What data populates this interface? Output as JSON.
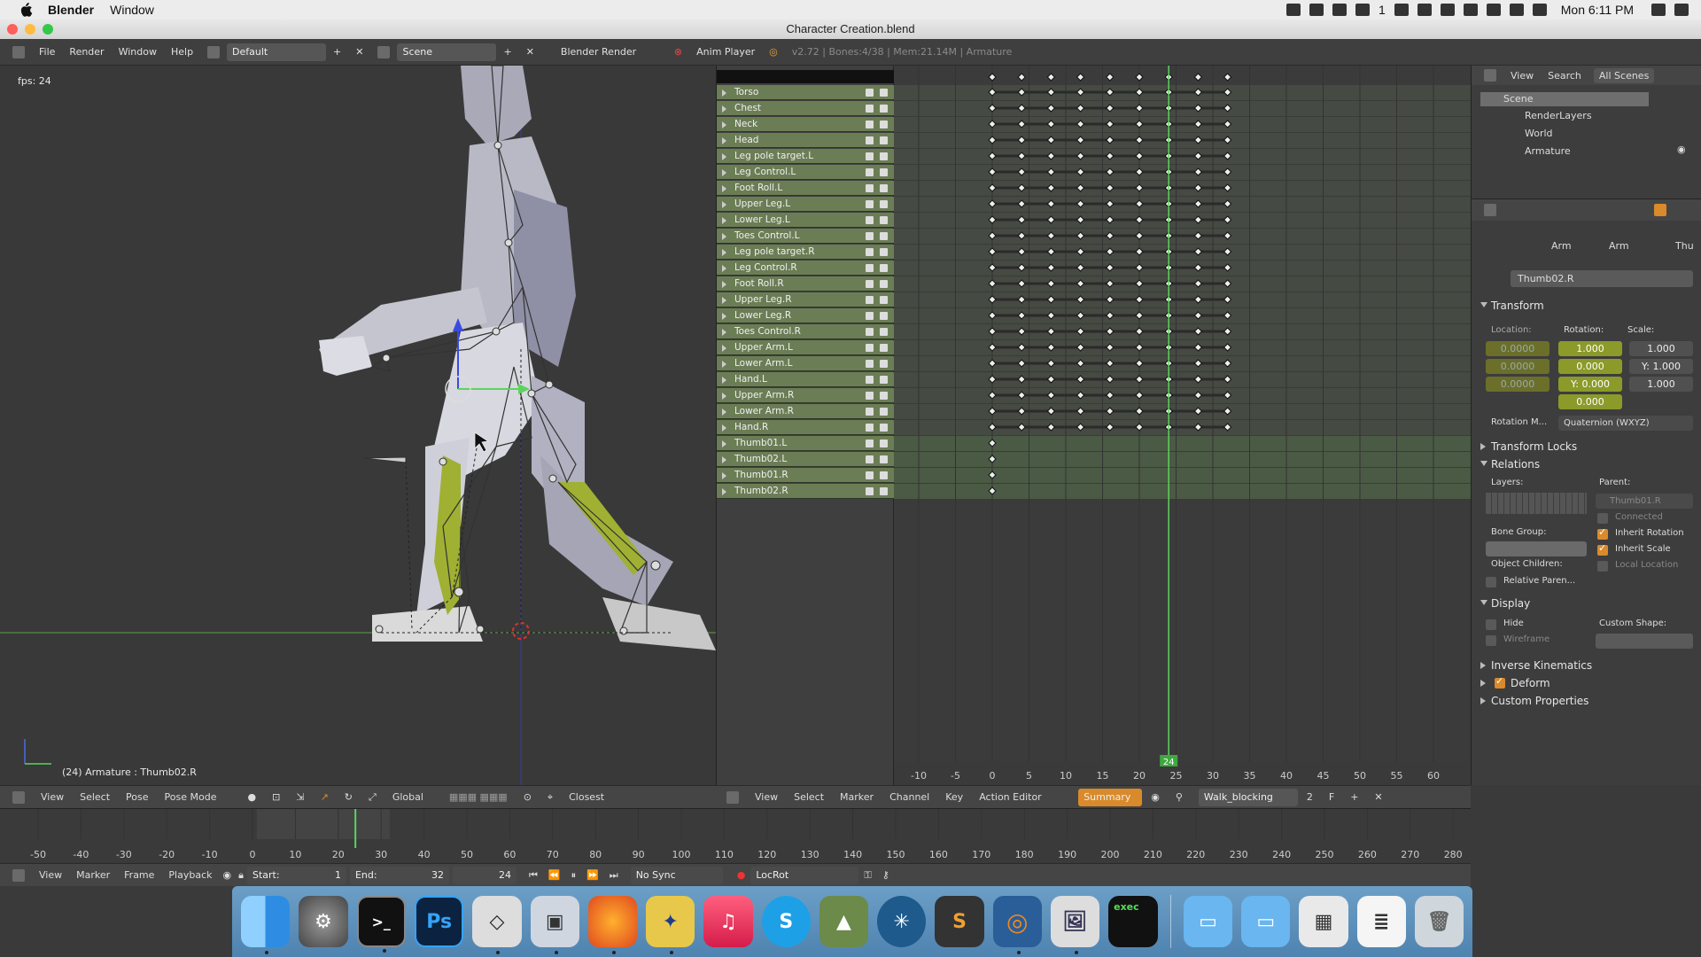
{
  "menubar": {
    "app_name": "Blender",
    "items": [
      "Window"
    ],
    "battery_label": "1",
    "clock": "Mon 6:11 PM"
  },
  "window": {
    "title": "Character Creation.blend"
  },
  "info_header": {
    "menus": [
      "File",
      "Render",
      "Window",
      "Help"
    ],
    "screen_layout": "Default",
    "scene": "Scene",
    "render_engine": "Blender Render",
    "anim_player": "Anim Player",
    "stats": "v2.72 | Bones:4/38 | Mem:21.14M | Armature"
  },
  "viewport": {
    "fps": "fps: 24",
    "object_info": "(24) Armature : Thumb02.R",
    "header": {
      "menus": [
        "View",
        "Select",
        "Pose"
      ],
      "mode": "Pose Mode",
      "orientation": "Global",
      "snap": "Closest"
    }
  },
  "dopesheet": {
    "channels": [
      {
        "name": "Torso",
        "keys": "full"
      },
      {
        "name": "Chest",
        "keys": "full"
      },
      {
        "name": "Neck",
        "keys": "full"
      },
      {
        "name": "Head",
        "keys": "full"
      },
      {
        "name": "Leg pole target.L",
        "keys": "full"
      },
      {
        "name": "Leg Control.L",
        "keys": "full"
      },
      {
        "name": "Foot Roll.L",
        "keys": "full"
      },
      {
        "name": "Upper Leg.L",
        "keys": "full"
      },
      {
        "name": "Lower Leg.L",
        "keys": "full"
      },
      {
        "name": "Toes Control.L",
        "keys": "full"
      },
      {
        "name": "Leg pole target.R",
        "keys": "full"
      },
      {
        "name": "Leg Control.R",
        "keys": "full"
      },
      {
        "name": "Foot Roll.R",
        "keys": "full"
      },
      {
        "name": "Upper Leg.R",
        "keys": "full"
      },
      {
        "name": "Lower Leg.R",
        "keys": "full"
      },
      {
        "name": "Toes Control.R",
        "keys": "full"
      },
      {
        "name": "Upper Arm.L",
        "keys": "full"
      },
      {
        "name": "Lower Arm.L",
        "keys": "full"
      },
      {
        "name": "Hand.L",
        "keys": "full"
      },
      {
        "name": "Upper Arm.R",
        "keys": "full"
      },
      {
        "name": "Lower Arm.R",
        "keys": "full"
      },
      {
        "name": "Hand.R",
        "keys": "full"
      },
      {
        "name": "Thumb01.L",
        "keys": "single"
      },
      {
        "name": "Thumb02.L",
        "keys": "single"
      },
      {
        "name": "Thumb01.R",
        "keys": "single"
      },
      {
        "name": "Thumb02.R",
        "keys": "single"
      }
    ],
    "key_frames": [
      0,
      4,
      8,
      12,
      16,
      20,
      24,
      28,
      32
    ],
    "current_frame": "24",
    "ruler": [
      "-10",
      "-5",
      "0",
      "5",
      "10",
      "15",
      "20",
      "25",
      "30",
      "35",
      "40",
      "45",
      "50",
      "55",
      "60"
    ],
    "header": {
      "menus": [
        "View",
        "Select",
        "Marker",
        "Channel",
        "Key"
      ],
      "editor": "Action Editor",
      "summary": "Summary",
      "action": "Walk_blocking",
      "users": "2",
      "fake_user": "F"
    }
  },
  "outliner": {
    "header": {
      "view": "View",
      "search": "Search",
      "filter": "All Scenes"
    },
    "items": [
      "Scene",
      "RenderLayers",
      "World",
      "Armature"
    ]
  },
  "properties": {
    "tabs": [
      "Arm",
      "Arm",
      "Thu"
    ],
    "bone_name": "Thumb02.R",
    "transform": {
      "label": "Transform",
      "location_label": "Location:",
      "rotation_label": "Rotation:",
      "scale_label": "Scale:",
      "location": [
        "0.0000",
        "0.0000",
        "0.0000"
      ],
      "rotation": [
        "1.000",
        "0.000",
        "Y: 0.000",
        "0.000"
      ],
      "scale": [
        "1.000",
        "Y: 1.000",
        "1.000"
      ],
      "rotation_mode_label": "Rotation M...",
      "rotation_mode": "Quaternion (WXYZ)"
    },
    "panels": {
      "transform_locks": "Transform Locks",
      "relations": "Relations",
      "display": "Display",
      "inverse_kinematics": "Inverse Kinematics",
      "deform": "Deform",
      "custom_properties": "Custom Properties"
    },
    "relations": {
      "layers_label": "Layers:",
      "parent_label": "Parent:",
      "parent_value": "Thumb01.R",
      "connected": "Connected",
      "inherit_rotation": "Inherit Rotation",
      "inherit_scale": "Inherit Scale",
      "bone_group_label": "Bone Group:",
      "object_children_label": "Object Children:",
      "local_location": "Local Location",
      "relative_parent": "Relative Paren..."
    },
    "display": {
      "hide": "Hide",
      "custom_shape_label": "Custom Shape:",
      "wireframe": "Wireframe"
    }
  },
  "timeline": {
    "ruler": [
      "-50",
      "-40",
      "-30",
      "-20",
      "-10",
      "0",
      "10",
      "20",
      "30",
      "40",
      "50",
      "60",
      "70",
      "80",
      "90",
      "100",
      "110",
      "120",
      "130",
      "140",
      "150",
      "160",
      "170",
      "180",
      "190",
      "200",
      "210",
      "220",
      "230",
      "240",
      "250",
      "260",
      "270",
      "280"
    ],
    "current_frame": 24,
    "header": {
      "menus": [
        "View",
        "Marker",
        "Frame",
        "Playback"
      ],
      "start_label": "Start:",
      "start": "1",
      "end_label": "End:",
      "end": "32",
      "frame": "24",
      "sync": "No Sync",
      "keying_set": "LocRot"
    }
  },
  "dock": {
    "apps": [
      "finder-icon",
      "system-preferences-icon",
      "terminal-icon",
      "photoshop-icon",
      "unity-icon",
      "photo-slideshow-icon",
      "firefox-icon",
      "cinema-icon",
      "itunes-icon",
      "skype-icon",
      "app-icon",
      "sourcetree-icon",
      "sublime-text-icon",
      "blender-icon",
      "preview-icon",
      "exec-icon"
    ],
    "labels": {
      "photoshop": "Ps",
      "skype": "S",
      "sublime": "S",
      "exec": "exec"
    },
    "colors": {
      "dock": "#5b8fbb"
    }
  },
  "colors": {
    "channel_green": "#6b7d55",
    "current_frame_line": "#5dd35d",
    "accent_orange": "#d98a2b",
    "rotation_field": "#8c9a2a"
  }
}
